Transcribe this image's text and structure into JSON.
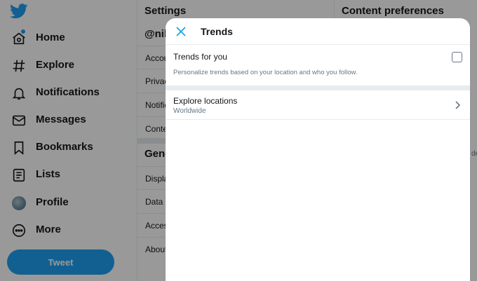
{
  "sidebar": {
    "logo_icon": "twitter-bird-icon",
    "brand_color": "#1da1f2",
    "items": [
      {
        "label": "Home",
        "icon": "home-icon"
      },
      {
        "label": "Explore",
        "icon": "hashtag-icon"
      },
      {
        "label": "Notifications",
        "icon": "bell-icon"
      },
      {
        "label": "Messages",
        "icon": "envelope-icon"
      },
      {
        "label": "Bookmarks",
        "icon": "bookmark-icon"
      },
      {
        "label": "Lists",
        "icon": "list-icon"
      },
      {
        "label": "Profile",
        "icon": "avatar"
      },
      {
        "label": "More",
        "icon": "more-icon"
      }
    ],
    "tweet_button": "Tweet"
  },
  "settings": {
    "title": "Settings",
    "username": "@nila",
    "rows_account": [
      "Accou",
      "Privacy",
      "Notific",
      "Conten"
    ],
    "section_general": "Gene",
    "rows_general": [
      "Display",
      "Data u",
      "Access",
      "About"
    ]
  },
  "content": {
    "title": "Content preferences",
    "faint_text": "de"
  },
  "modal": {
    "title": "Trends",
    "trends_for_you": {
      "label": "Trends for you",
      "description": "Personalize trends based on your location and who you follow.",
      "checked": false
    },
    "explore_locations": {
      "label": "Explore locations",
      "value": "Worldwide"
    }
  },
  "colors": {
    "accent": "#1da1f2",
    "overlay": "rgba(0,0,0,0.40)",
    "secondary_text": "#657786"
  }
}
